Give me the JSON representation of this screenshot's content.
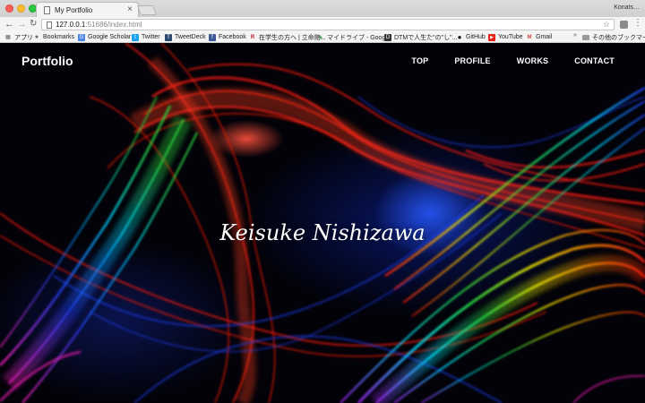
{
  "browser": {
    "tab_title": "My Portfolio",
    "tab_close": "×",
    "profile_name": "Konats…",
    "url_host": "127.0.0.1",
    "url_rest": ":51686/index.html",
    "nav": {
      "back": "←",
      "forward": "→",
      "reload": "↻",
      "star": "☆",
      "menu": "⋮"
    }
  },
  "bookmarks": [
    {
      "label": "アプリ",
      "icon": "apps-grid-icon",
      "color": "#555555",
      "glyph": "▦"
    },
    {
      "label": "Bookmarks",
      "icon": "star-icon",
      "color": "#555555",
      "glyph": "★"
    },
    {
      "label": "Google Scholar",
      "icon": "scholar-icon",
      "color": "#4a86e8",
      "glyph": "G"
    },
    {
      "label": "Twitter",
      "icon": "twitter-bird-icon",
      "color": "#1da1f2",
      "glyph": "t"
    },
    {
      "label": "TweetDeck",
      "icon": "tweetdeck-icon",
      "color": "#2b4a6f",
      "glyph": "T"
    },
    {
      "label": "Facebook",
      "icon": "facebook-icon",
      "color": "#3b5998",
      "glyph": "f"
    },
    {
      "label": "在学生の方へ | 立命館...",
      "icon": "ritsumeikan-icon",
      "color": "#b5132a",
      "glyph": "R"
    },
    {
      "label": "マイドライブ - Googl...",
      "icon": "google-drive-icon",
      "color": "#34a853",
      "glyph": "▲"
    },
    {
      "label": "DTMで人生た\"の\"し\"...",
      "icon": "dtm-icon",
      "color": "#333333",
      "glyph": "D"
    },
    {
      "label": "GitHub",
      "icon": "github-icon",
      "color": "#111111",
      "glyph": "●"
    },
    {
      "label": "YouTube",
      "icon": "youtube-icon",
      "color": "#e62117",
      "glyph": "▶"
    },
    {
      "label": "Gmail",
      "icon": "gmail-icon",
      "color": "#d44638",
      "glyph": "M"
    }
  ],
  "bookmarks_more": "»",
  "bookmarks_other": "その他のブックマーク",
  "site": {
    "logo": "Portfolio",
    "nav": [
      "TOP",
      "PROFILE",
      "WORKS",
      "CONTACT"
    ],
    "hero_name": "Keisuke Nishizawa"
  },
  "colors": {
    "stream_red": "#ff1a10",
    "stream_orange": "#ff8a00",
    "stream_yellow": "#f5f000",
    "stream_green": "#28e040",
    "stream_cyan": "#00d8ff",
    "stream_blue": "#2240ff",
    "stream_purple": "#a020f0",
    "stream_magenta": "#ff20c0"
  }
}
